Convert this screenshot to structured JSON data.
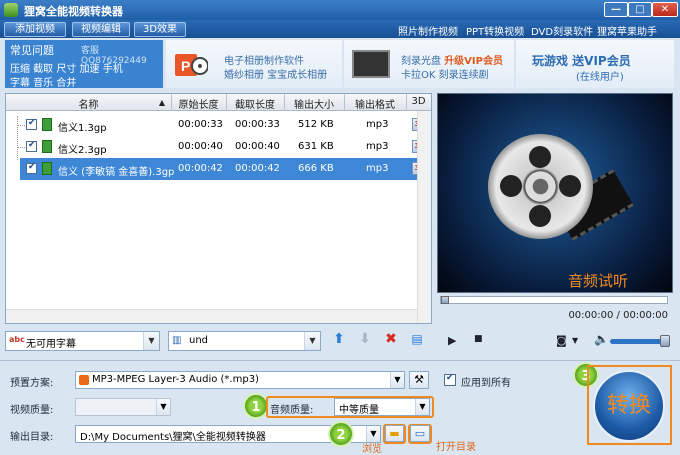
{
  "window": {
    "title": "狸窝全能视频转换器",
    "min": "—",
    "max": "□",
    "close": "✕"
  },
  "toolbar": {
    "add_video": "添加视频",
    "edit_video": "视频编辑",
    "effect_3d": "3D效果",
    "links": [
      "照片制作视频",
      "PPT转换视频",
      "DVD刻录软件",
      "狸窝苹果助手"
    ]
  },
  "faq": {
    "title": "常见问题",
    "qq": "客服QQ876292449",
    "row1": "压缩 截取 尺寸 加速 手机",
    "row2": "字幕 音乐 合并"
  },
  "ads": {
    "a_line1": "电子相册制作软件",
    "a_line2": "婚纱相册 宝宝成长相册",
    "b_line1_prefix": "刻录光盘 ",
    "b_line1_vip": "升级VIP会员",
    "b_line2": "卡拉OK 刻录连续剧",
    "c_line1": "玩游戏 送VIP会员",
    "c_line2": "(在线用户)"
  },
  "table": {
    "headers": [
      "名称",
      "原始长度",
      "截取长度",
      "输出大小",
      "输出格式",
      "3D"
    ],
    "rows": [
      {
        "name": "信义1.3gp",
        "orig": "00:00:33",
        "cut": "00:00:33",
        "size": "512 KB",
        "fmt": "mp3",
        "badge": "3D",
        "selected": false
      },
      {
        "name": "信义2.3gp",
        "orig": "00:00:40",
        "cut": "00:00:40",
        "size": "631 KB",
        "fmt": "mp3",
        "badge": "3D",
        "selected": false
      },
      {
        "name": "信义 (李敏镐 金喜善).3gp",
        "orig": "00:00:42",
        "cut": "00:00:42",
        "size": "666 KB",
        "fmt": "mp3",
        "badge": "3D",
        "selected": true
      }
    ]
  },
  "subtitle_select": "无可用字幕",
  "audio_track_select": "und",
  "preview": {
    "label": "音频试听",
    "time": "00:00:00 / 00:00:00",
    "seek": 0
  },
  "settings": {
    "preset_label": "预置方案:",
    "preset_value": "MP3-MPEG Layer-3 Audio (*.mp3)",
    "apply_all": "应用到所有",
    "video_quality_label": "视频质量:",
    "audio_quality_label": "音频质量:",
    "audio_quality_value": "中等质量",
    "output_label": "输出目录:",
    "output_value": "D:\\My Documents\\狸窝\\全能视频转换器",
    "browse": "浏览",
    "open_dir": "打开目录"
  },
  "badges": [
    "1",
    "2",
    "3"
  ],
  "convert_label": "转换",
  "colors": {
    "accent": "#2a6ab5",
    "highlight": "#f08a20",
    "selected_row": "#3d87d6"
  }
}
